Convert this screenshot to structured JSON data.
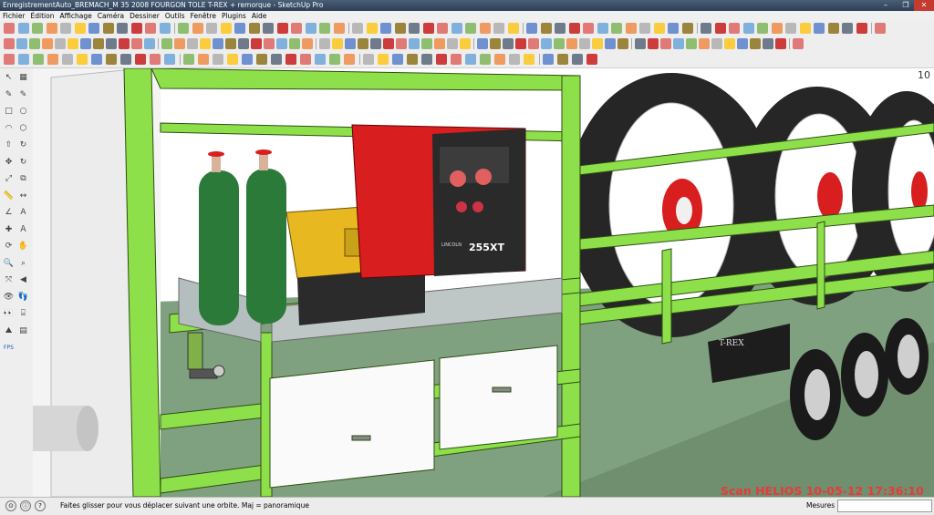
{
  "window": {
    "title": "EnregistrementAuto_BREMACH_M 35 2008  FOURGON TOLE T-REX + remorque - SketchUp Pro",
    "controls": [
      "–",
      "❐",
      "✕"
    ]
  },
  "menus": [
    "Fichier",
    "Édition",
    "Affichage",
    "Caméra",
    "Dessiner",
    "Outils",
    "Fenêtre",
    "Plugins",
    "Aide"
  ],
  "toolbar_row1_icons": [
    "select",
    "eraser",
    "pencil",
    "rectangle",
    "circle",
    "arc",
    "push-pull",
    "paint",
    "move",
    "rotate",
    "scale",
    "offset",
    "follow-me",
    "tape",
    "text",
    "axes",
    "3d-text",
    "section",
    "dimensions",
    "protractor",
    "orbit",
    "pan",
    "zoom",
    "zoom-window",
    "zoom-extents",
    "previous",
    "next",
    "position-camera",
    "walk",
    "look-around",
    "section-plane",
    "display-section",
    "sandbox",
    "from-contours",
    "stamp",
    "drape",
    "add-detail",
    "flip-edge",
    "smoove",
    "iso",
    "top",
    "front",
    "right",
    "back",
    "left",
    "xray",
    "wireframe",
    "hidden-line",
    "shaded",
    "textured",
    "monochrome",
    "layer-a",
    "layer-b",
    "layer-c",
    "layer-d",
    "layer-e",
    "layer-f",
    "layer-g",
    "component",
    "group",
    "outliner"
  ],
  "toolbar_row2_icons": [
    "select",
    "eraser",
    "pencil",
    "line",
    "arc",
    "rectangle",
    "circle",
    "polygon",
    "push-pull",
    "follow-me",
    "move",
    "rotate",
    "scale",
    "offset",
    "tape",
    "dimension",
    "protractor",
    "text",
    "axes",
    "3d-text",
    "paint",
    "section",
    "walk",
    "component",
    "rubik",
    "tape2",
    "flag",
    "plugin-a",
    "plugin-b",
    "plugin-c",
    "plugin-d",
    "plugin-e",
    "plugin-f",
    "plugin-g",
    "plugin-h",
    "plugin-i",
    "plugin-j",
    "plugin-k",
    "plugin-l",
    "plugin-m",
    "style-a",
    "style-b",
    "style-c",
    "style-d",
    "style-e",
    "style-f",
    "style-g",
    "style-h",
    "style-i",
    "style-j",
    "style-k",
    "style-l",
    "style-m",
    "style-n",
    "style-o",
    "scene-a",
    "scene-b",
    "scene-c",
    "scene-d",
    "scene-e",
    "scene-f"
  ],
  "toolbar_row3_icons": [
    "shadow",
    "fog",
    "pointer",
    "sun",
    "sketch",
    "dot",
    "axes",
    "lock",
    "export",
    "import",
    "view-a",
    "view-b",
    "view-c",
    "view-d",
    "view-e",
    "view-f",
    "view-g",
    "view-h",
    "view-i",
    "view-j",
    "view-k",
    "view-l",
    "view-m",
    "view-n",
    "view-o",
    "view-p",
    "view-q",
    "view-r",
    "view-s",
    "view-t",
    "view-u",
    "view-v",
    "view-w",
    "view-x",
    "view-y",
    "view-z",
    "view-aa",
    "view-ab",
    "view-ac",
    "view-ad"
  ],
  "left_toolbar_icons": [
    "select",
    "paint",
    "eraser",
    "pencil",
    "rectangle",
    "circle",
    "arc",
    "polygon",
    "push-pull",
    "follow-me",
    "move",
    "rotate",
    "scale",
    "offset",
    "tape",
    "dimension",
    "protractor",
    "text",
    "axes",
    "3d-text",
    "orbit",
    "pan",
    "zoom",
    "zoom-window",
    "zoom-extents",
    "previous",
    "position-camera",
    "walk",
    "look-around",
    "section",
    "sandbox",
    "display-section",
    "fps"
  ],
  "left_toolbar_glyphs": [
    "↖",
    "▦",
    "✎",
    "✎",
    "□",
    "○",
    "◠",
    "⬡",
    "⇧",
    "↻",
    "✥",
    "↻",
    "⤢",
    "⧉",
    "📏",
    "↔",
    "∠",
    "A",
    "✚",
    "Ａ",
    "⟳",
    "✋",
    "🔍",
    "⌕",
    "⤧",
    "◀",
    "👁",
    "👣",
    "👀",
    "⌸",
    "⛰",
    "▤",
    "FPS"
  ],
  "model": {
    "trailer_brand": "T-REX",
    "welder_model": "255XT",
    "welder_brand": "LINCOLN"
  },
  "corner_label": "10",
  "statusbar": {
    "hint": "Faites glisser pour vous déplacer suivant une orbite.  Maj = panoramique",
    "mesures_label": "Mesures",
    "mesures_value": ""
  },
  "watermark": "Scan HELIOS 10-05-12 17:36:10",
  "colors": {
    "frame_green": "#8ee04a",
    "ground": "#7fa17f",
    "welder_red": "#d81e1e",
    "generator_yellow": "#e8b820",
    "gas_bottle": "#2c7a3a"
  }
}
